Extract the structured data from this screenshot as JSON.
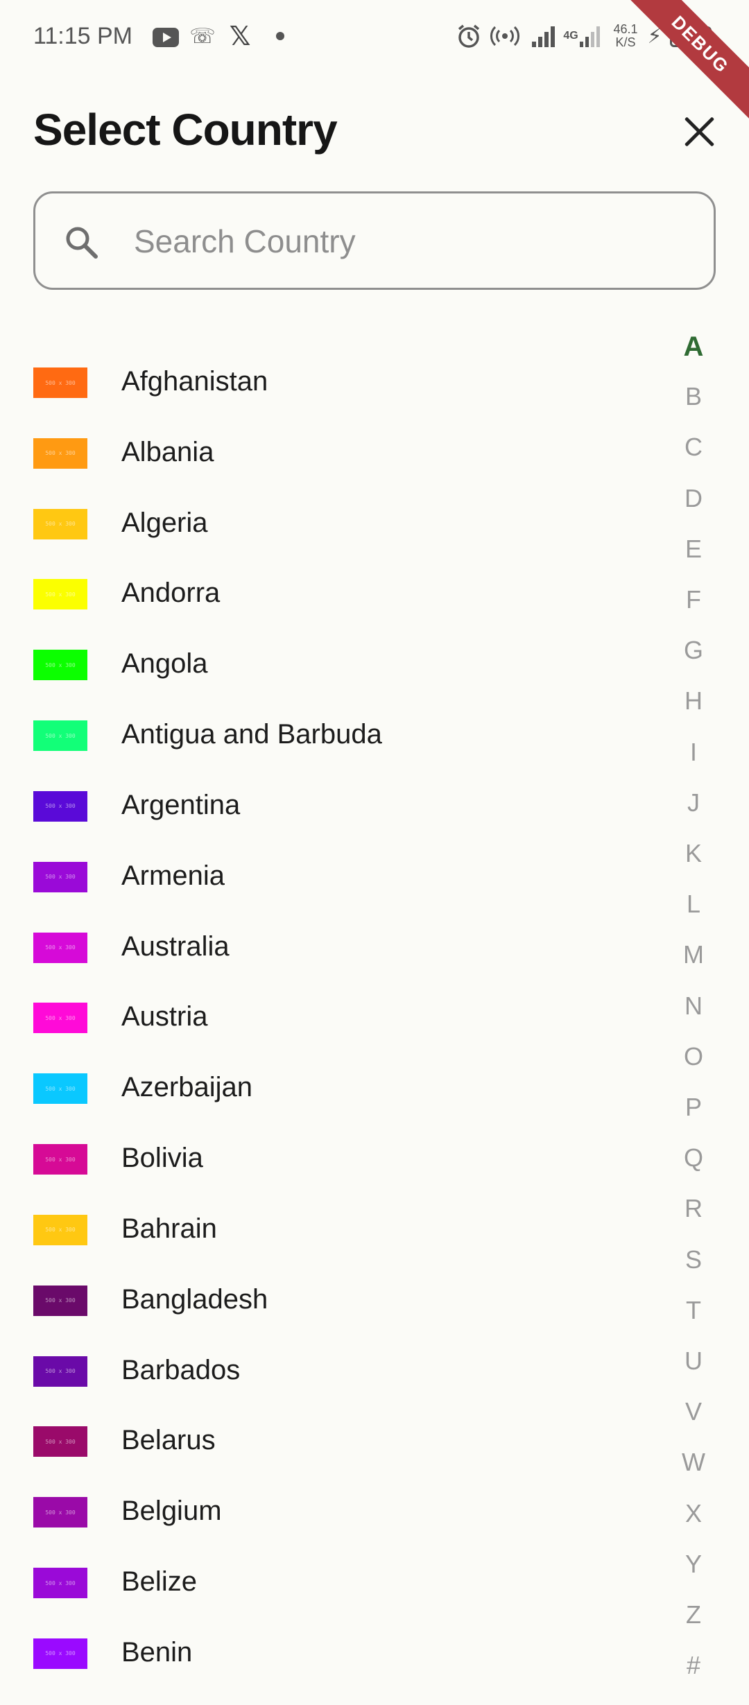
{
  "status_bar": {
    "time": "11:15 PM",
    "net_type": "4G",
    "net_speed_value": "46.1",
    "net_speed_unit": "K/S",
    "icons": [
      "youtube-icon",
      "bot-icon",
      "x-logo-icon",
      "dot-icon",
      "alarm-icon",
      "hotspot-icon",
      "signal-icon",
      "signal-4g-icon",
      "charging-icon",
      "battery-icon"
    ],
    "debug_label": "DEBUG"
  },
  "header": {
    "title": "Select Country"
  },
  "search": {
    "placeholder": "Search Country",
    "value": ""
  },
  "countries": [
    {
      "name": "Afghanistan",
      "flag_color": "#ff6a12",
      "flag_text": "500 x 300"
    },
    {
      "name": "Albania",
      "flag_color": "#ff9a12",
      "flag_text": "500 x 300"
    },
    {
      "name": "Algeria",
      "flag_color": "#ffc812",
      "flag_text": "500 x 300"
    },
    {
      "name": "Andorra",
      "flag_color": "#fbff00",
      "flag_text": "500 x 300"
    },
    {
      "name": "Angola",
      "flag_color": "#0cff00",
      "flag_text": "500 x 300"
    },
    {
      "name": "Antigua and Barbuda",
      "flag_color": "#12ff78",
      "flag_text": "500 x 300"
    },
    {
      "name": "Argentina",
      "flag_color": "#5a0ad8",
      "flag_text": "500 x 300"
    },
    {
      "name": "Armenia",
      "flag_color": "#9a0ad8",
      "flag_text": "500 x 300"
    },
    {
      "name": "Australia",
      "flag_color": "#d60ad8",
      "flag_text": "500 x 300"
    },
    {
      "name": "Austria",
      "flag_color": "#ff0ad8",
      "flag_text": "500 x 300"
    },
    {
      "name": "Azerbaijan",
      "flag_color": "#0ac8ff",
      "flag_text": "500 x 300"
    },
    {
      "name": "Bolivia",
      "flag_color": "#d60a96",
      "flag_text": "500 x 300"
    },
    {
      "name": "Bahrain",
      "flag_color": "#ffc812",
      "flag_text": "500 x 300"
    },
    {
      "name": "Bangladesh",
      "flag_color": "#6a0a6a",
      "flag_text": "500 x 300"
    },
    {
      "name": "Barbados",
      "flag_color": "#6a0aa8",
      "flag_text": "500 x 300"
    },
    {
      "name": "Belarus",
      "flag_color": "#9a0a6a",
      "flag_text": "500 x 300"
    },
    {
      "name": "Belgium",
      "flag_color": "#9a0aa8",
      "flag_text": "500 x 300"
    },
    {
      "name": "Belize",
      "flag_color": "#9a0ad8",
      "flag_text": "500 x 300"
    },
    {
      "name": "Benin",
      "flag_color": "#9a0aff",
      "flag_text": "500 x 300"
    }
  ],
  "alphabet": [
    "A",
    "B",
    "C",
    "D",
    "E",
    "F",
    "G",
    "H",
    "I",
    "J",
    "K",
    "L",
    "M",
    "N",
    "O",
    "P",
    "Q",
    "R",
    "S",
    "T",
    "U",
    "V",
    "W",
    "X",
    "Y",
    "Z",
    "#"
  ],
  "active_letter": "A"
}
